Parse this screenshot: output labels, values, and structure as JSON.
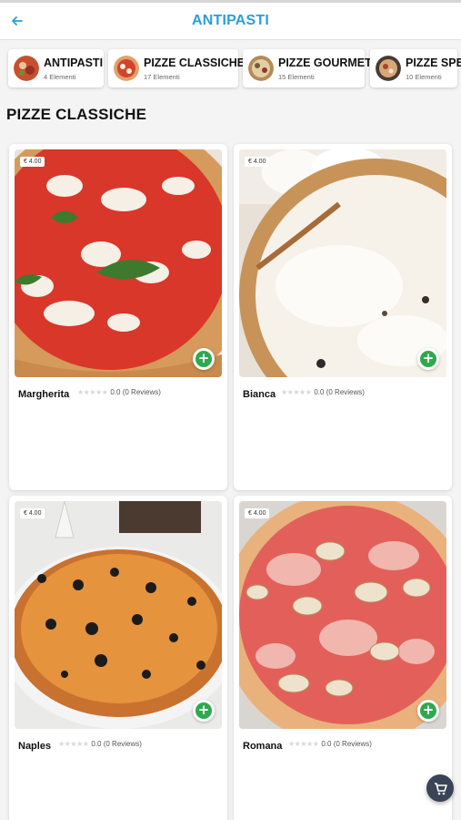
{
  "header": {
    "title": "ANTIPASTI",
    "back_icon": "arrow-left-icon"
  },
  "categories": [
    {
      "name": "ANTIPASTI",
      "count": "4 Elementi"
    },
    {
      "name": "PIZZE CLASSICHE",
      "count": "17 Elementi"
    },
    {
      "name": "PIZZE GOURMET",
      "count": "15 Elementi"
    },
    {
      "name": "PIZZE SPE",
      "count": "10 Elementi"
    }
  ],
  "section": {
    "title": "PIZZE CLASSICHE"
  },
  "products": [
    {
      "name": "Margherita",
      "price": "€ 4.00",
      "rating": "0.0 (0 Reviews)",
      "stars": "★★★★★"
    },
    {
      "name": "Bianca",
      "price": "€ 4.00",
      "rating": "0.0 (0 Reviews)",
      "stars": "★★★★★"
    },
    {
      "name": "Naples",
      "price": "€ 4.00",
      "rating": "0.0 (0 Reviews)",
      "stars": "★★★★★"
    },
    {
      "name": "Romana",
      "price": "€ 4.00",
      "rating": "0.0 (0 Reviews)",
      "stars": "★★★★★"
    }
  ],
  "colors": {
    "accent": "#2a9fd8",
    "add_button": "#2da94f",
    "cart_fab": "#3a4456"
  },
  "cart": {
    "icon": "cart-icon"
  }
}
